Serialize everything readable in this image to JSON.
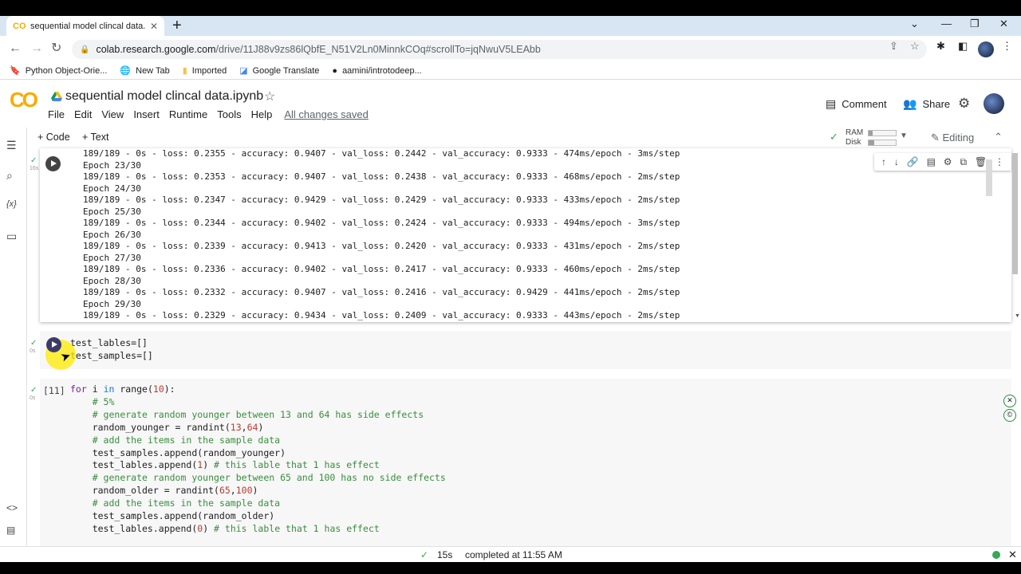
{
  "browser": {
    "tab_title": "sequential model clincal data.ipyb",
    "tab_favicon": "CO",
    "new_tab_icon": "+",
    "url_host": "colab.research.google.com",
    "url_path": "/drive/11J88v9zs86lQbfE_N51V2Ln0MinnkCOq#scrollTo=jqNwuV5LEAbb",
    "bookmarks": [
      "Python Object-Orie...",
      "New Tab",
      "Imported",
      "Google Translate",
      "aamini/introtodeep..."
    ]
  },
  "colab": {
    "logo": "CO",
    "notebook_title": "sequential model clincal data.ipynb",
    "menu": [
      "File",
      "Edit",
      "View",
      "Insert",
      "Runtime",
      "Tools",
      "Help"
    ],
    "saved_status": "All changes saved",
    "comment_label": "Comment",
    "share_label": "Share",
    "add_code_label": "+ Code",
    "add_text_label": "+ Text",
    "ram_label": "RAM",
    "disk_label": "Disk",
    "ram_usage": 0.15,
    "disk_usage": 0.2,
    "editing_label": "Editing"
  },
  "cells": {
    "output_lines": [
      "189/189 - 0s - loss: 0.2355 - accuracy: 0.9407 - val_loss: 0.2442 - val_accuracy: 0.9333 - 474ms/epoch - 3ms/step",
      "Epoch 23/30",
      "189/189 - 0s - loss: 0.2353 - accuracy: 0.9407 - val_loss: 0.2438 - val_accuracy: 0.9333 - 468ms/epoch - 2ms/step",
      "Epoch 24/30",
      "189/189 - 0s - loss: 0.2347 - accuracy: 0.9429 - val_loss: 0.2429 - val_accuracy: 0.9333 - 433ms/epoch - 2ms/step",
      "Epoch 25/30",
      "189/189 - 0s - loss: 0.2344 - accuracy: 0.9402 - val_loss: 0.2424 - val_accuracy: 0.9333 - 494ms/epoch - 3ms/step",
      "Epoch 26/30",
      "189/189 - 0s - loss: 0.2339 - accuracy: 0.9413 - val_loss: 0.2420 - val_accuracy: 0.9333 - 431ms/epoch - 2ms/step",
      "Epoch 27/30",
      "189/189 - 0s - loss: 0.2336 - accuracy: 0.9402 - val_loss: 0.2417 - val_accuracy: 0.9333 - 460ms/epoch - 2ms/step",
      "Epoch 28/30",
      "189/189 - 0s - loss: 0.2332 - accuracy: 0.9407 - val_loss: 0.2416 - val_accuracy: 0.9429 - 441ms/epoch - 2ms/step",
      "Epoch 29/30",
      "189/189 - 0s - loss: 0.2329 - accuracy: 0.9434 - val_loss: 0.2409 - val_accuracy: 0.9333 - 443ms/epoch - 2ms/step"
    ],
    "cell1_time": "16s",
    "cell2_time": "0s",
    "cell3_time": "0s",
    "cell3_exec_count": "[11]"
  },
  "status": {
    "elapsed": "15s",
    "completed": "completed at 11:55 AM"
  },
  "colors": {
    "accent_green": "#34a853",
    "logo_orange": "#f9ab00",
    "code_keyword": "#7b1fa2",
    "code_comment": "#388e3c"
  }
}
